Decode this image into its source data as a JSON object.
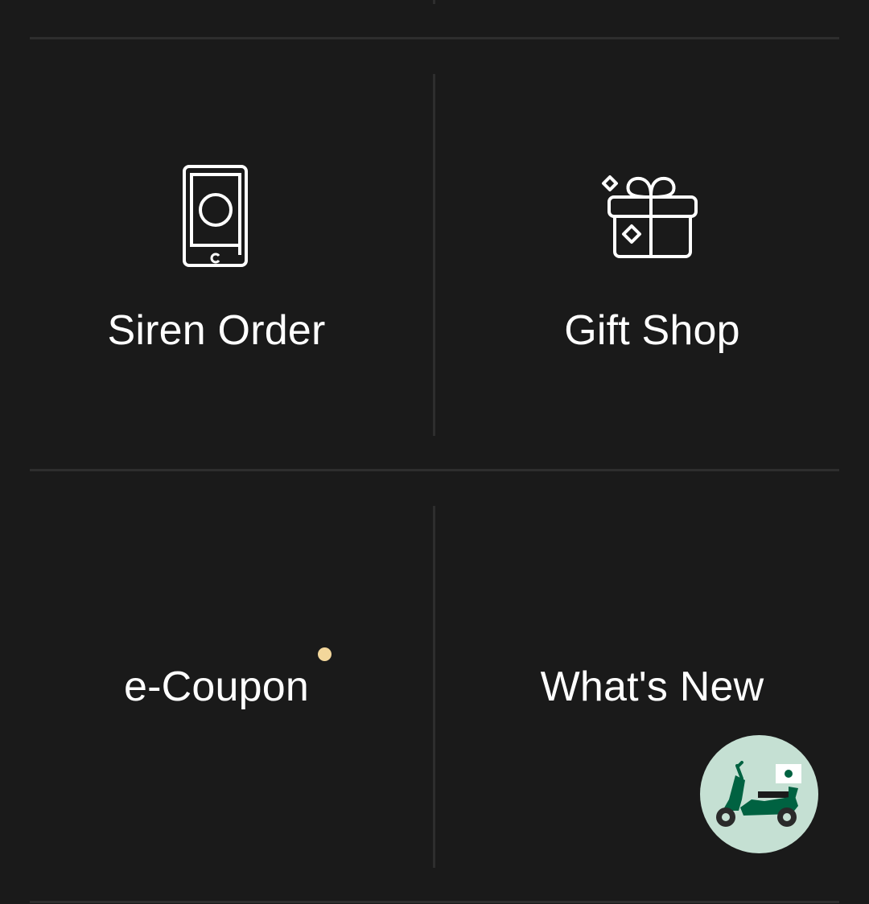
{
  "menu": {
    "items": [
      {
        "label": "Siren Order",
        "icon": "mobile-order-icon"
      },
      {
        "label": "Gift Shop",
        "icon": "gift-icon"
      },
      {
        "label": "e-Coupon",
        "icon": "",
        "has_new_dot": true
      },
      {
        "label": "What's New",
        "icon": ""
      }
    ]
  },
  "fab": {
    "icon": "delivery-scooter-icon"
  },
  "colors": {
    "background": "#1a1a1a",
    "divider": "#2e2e2e",
    "text": "#ffffff",
    "new_dot": "#f3d79b",
    "fab_background": "#c5e0d3",
    "scooter_green": "#006241"
  }
}
